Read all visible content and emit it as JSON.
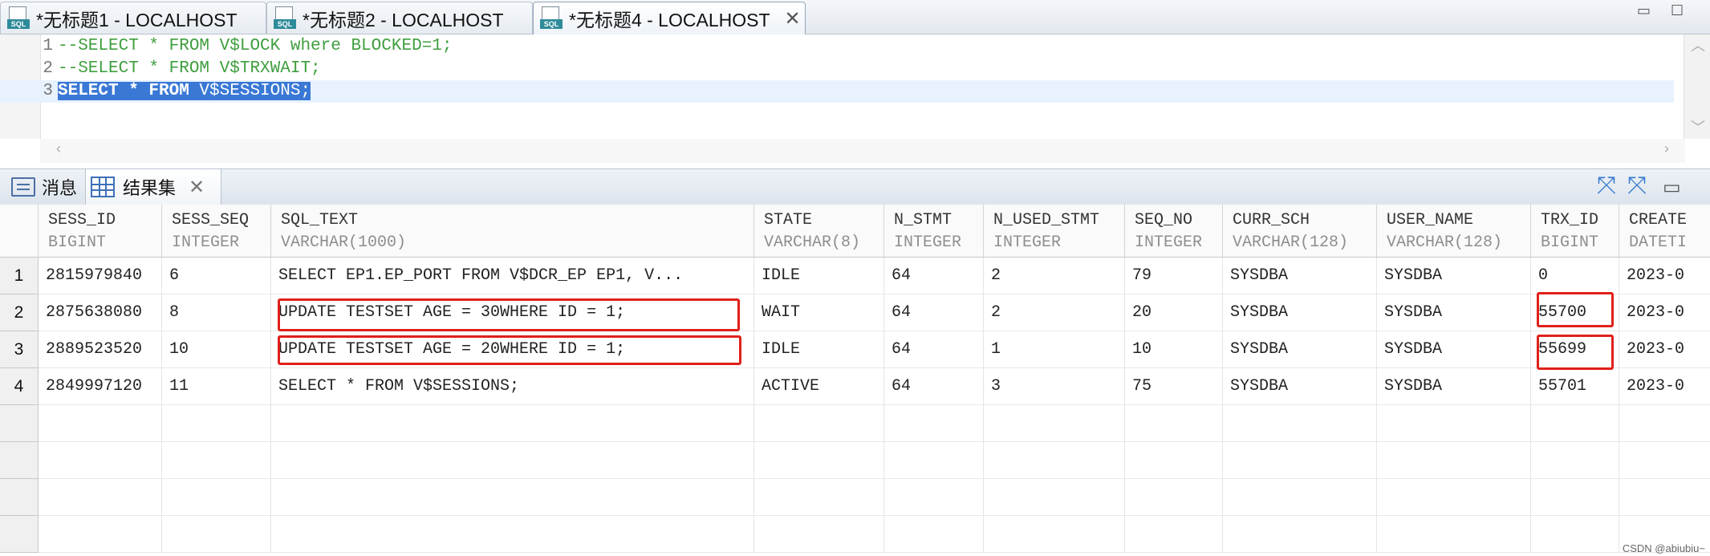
{
  "editor_tabs": [
    {
      "label": "*无标题1 - LOCALHOST",
      "active": false
    },
    {
      "label": "*无标题2 - LOCALHOST",
      "active": false
    },
    {
      "label": "*无标题4 - LOCALHOST",
      "active": true
    }
  ],
  "sql_icon_label": "SQL",
  "editor": {
    "lines": [
      {
        "num": "1",
        "text": "--SELECT * FROM V$LOCK where BLOCKED=1;"
      },
      {
        "num": "2",
        "text": "--SELECT * FROM V$TRXWAIT;"
      },
      {
        "num": "3",
        "kw1": "SELECT * FROM",
        "rest": " V$SESSIONS;"
      }
    ]
  },
  "result_tabs": {
    "messages": "消息",
    "result_set": "结果集"
  },
  "grid": {
    "columns": [
      {
        "name": "SESS_ID",
        "type": "BIGINT"
      },
      {
        "name": "SESS_SEQ",
        "type": "INTEGER"
      },
      {
        "name": "SQL_TEXT",
        "type": "VARCHAR(1000)"
      },
      {
        "name": "STATE",
        "type": "VARCHAR(8)"
      },
      {
        "name": "N_STMT",
        "type": "INTEGER"
      },
      {
        "name": "N_USED_STMT",
        "type": "INTEGER"
      },
      {
        "name": "SEQ_NO",
        "type": "INTEGER"
      },
      {
        "name": "CURR_SCH",
        "type": "VARCHAR(128)"
      },
      {
        "name": "USER_NAME",
        "type": "VARCHAR(128)"
      },
      {
        "name": "TRX_ID",
        "type": "BIGINT"
      },
      {
        "name": "CREATE",
        "type": "DATETI"
      }
    ],
    "rows": [
      {
        "num": "1",
        "cells": [
          "2815979840",
          "6",
          "SELECT EP1.EP_PORT FROM V$DCR_EP EP1, V...",
          "IDLE",
          "64",
          "2",
          "79",
          "SYSDBA",
          "SYSDBA",
          "0",
          "2023-0"
        ]
      },
      {
        "num": "2",
        "cells": [
          "2875638080",
          "8",
          "UPDATE TESTSET AGE = 30WHERE ID = 1;",
          "WAIT",
          "64",
          "2",
          "20",
          "SYSDBA",
          "SYSDBA",
          "55700",
          "2023-0"
        ]
      },
      {
        "num": "3",
        "cells": [
          "2889523520",
          "10",
          "UPDATE TESTSET AGE = 20WHERE ID = 1;",
          "IDLE",
          "64",
          "1",
          "10",
          "SYSDBA",
          "SYSDBA",
          "55699",
          "2023-0"
        ]
      },
      {
        "num": "4",
        "cells": [
          "2849997120",
          "11",
          "SELECT * FROM V$SESSIONS;",
          "ACTIVE",
          "64",
          "3",
          "75",
          "SYSDBA",
          "SYSDBA",
          "55701",
          "2023-0"
        ]
      }
    ]
  },
  "watermark": "CSDN @abiubiu~",
  "colors": {
    "highlight": "#e0201a",
    "selection": "#3a78d6",
    "comment": "#3f9e3f"
  }
}
